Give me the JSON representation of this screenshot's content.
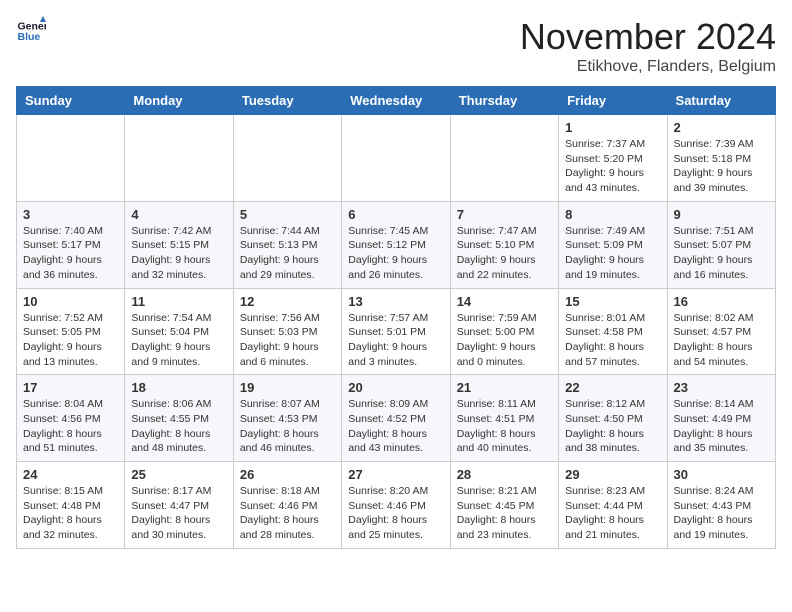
{
  "logo": {
    "line1": "General",
    "line2": "Blue"
  },
  "title": "November 2024",
  "location": "Etikhove, Flanders, Belgium",
  "days_of_week": [
    "Sunday",
    "Monday",
    "Tuesday",
    "Wednesday",
    "Thursday",
    "Friday",
    "Saturday"
  ],
  "weeks": [
    [
      {
        "day": "",
        "info": ""
      },
      {
        "day": "",
        "info": ""
      },
      {
        "day": "",
        "info": ""
      },
      {
        "day": "",
        "info": ""
      },
      {
        "day": "",
        "info": ""
      },
      {
        "day": "1",
        "info": "Sunrise: 7:37 AM\nSunset: 5:20 PM\nDaylight: 9 hours and 43 minutes."
      },
      {
        "day": "2",
        "info": "Sunrise: 7:39 AM\nSunset: 5:18 PM\nDaylight: 9 hours and 39 minutes."
      }
    ],
    [
      {
        "day": "3",
        "info": "Sunrise: 7:40 AM\nSunset: 5:17 PM\nDaylight: 9 hours and 36 minutes."
      },
      {
        "day": "4",
        "info": "Sunrise: 7:42 AM\nSunset: 5:15 PM\nDaylight: 9 hours and 32 minutes."
      },
      {
        "day": "5",
        "info": "Sunrise: 7:44 AM\nSunset: 5:13 PM\nDaylight: 9 hours and 29 minutes."
      },
      {
        "day": "6",
        "info": "Sunrise: 7:45 AM\nSunset: 5:12 PM\nDaylight: 9 hours and 26 minutes."
      },
      {
        "day": "7",
        "info": "Sunrise: 7:47 AM\nSunset: 5:10 PM\nDaylight: 9 hours and 22 minutes."
      },
      {
        "day": "8",
        "info": "Sunrise: 7:49 AM\nSunset: 5:09 PM\nDaylight: 9 hours and 19 minutes."
      },
      {
        "day": "9",
        "info": "Sunrise: 7:51 AM\nSunset: 5:07 PM\nDaylight: 9 hours and 16 minutes."
      }
    ],
    [
      {
        "day": "10",
        "info": "Sunrise: 7:52 AM\nSunset: 5:05 PM\nDaylight: 9 hours and 13 minutes."
      },
      {
        "day": "11",
        "info": "Sunrise: 7:54 AM\nSunset: 5:04 PM\nDaylight: 9 hours and 9 minutes."
      },
      {
        "day": "12",
        "info": "Sunrise: 7:56 AM\nSunset: 5:03 PM\nDaylight: 9 hours and 6 minutes."
      },
      {
        "day": "13",
        "info": "Sunrise: 7:57 AM\nSunset: 5:01 PM\nDaylight: 9 hours and 3 minutes."
      },
      {
        "day": "14",
        "info": "Sunrise: 7:59 AM\nSunset: 5:00 PM\nDaylight: 9 hours and 0 minutes."
      },
      {
        "day": "15",
        "info": "Sunrise: 8:01 AM\nSunset: 4:58 PM\nDaylight: 8 hours and 57 minutes."
      },
      {
        "day": "16",
        "info": "Sunrise: 8:02 AM\nSunset: 4:57 PM\nDaylight: 8 hours and 54 minutes."
      }
    ],
    [
      {
        "day": "17",
        "info": "Sunrise: 8:04 AM\nSunset: 4:56 PM\nDaylight: 8 hours and 51 minutes."
      },
      {
        "day": "18",
        "info": "Sunrise: 8:06 AM\nSunset: 4:55 PM\nDaylight: 8 hours and 48 minutes."
      },
      {
        "day": "19",
        "info": "Sunrise: 8:07 AM\nSunset: 4:53 PM\nDaylight: 8 hours and 46 minutes."
      },
      {
        "day": "20",
        "info": "Sunrise: 8:09 AM\nSunset: 4:52 PM\nDaylight: 8 hours and 43 minutes."
      },
      {
        "day": "21",
        "info": "Sunrise: 8:11 AM\nSunset: 4:51 PM\nDaylight: 8 hours and 40 minutes."
      },
      {
        "day": "22",
        "info": "Sunrise: 8:12 AM\nSunset: 4:50 PM\nDaylight: 8 hours and 38 minutes."
      },
      {
        "day": "23",
        "info": "Sunrise: 8:14 AM\nSunset: 4:49 PM\nDaylight: 8 hours and 35 minutes."
      }
    ],
    [
      {
        "day": "24",
        "info": "Sunrise: 8:15 AM\nSunset: 4:48 PM\nDaylight: 8 hours and 32 minutes."
      },
      {
        "day": "25",
        "info": "Sunrise: 8:17 AM\nSunset: 4:47 PM\nDaylight: 8 hours and 30 minutes."
      },
      {
        "day": "26",
        "info": "Sunrise: 8:18 AM\nSunset: 4:46 PM\nDaylight: 8 hours and 28 minutes."
      },
      {
        "day": "27",
        "info": "Sunrise: 8:20 AM\nSunset: 4:46 PM\nDaylight: 8 hours and 25 minutes."
      },
      {
        "day": "28",
        "info": "Sunrise: 8:21 AM\nSunset: 4:45 PM\nDaylight: 8 hours and 23 minutes."
      },
      {
        "day": "29",
        "info": "Sunrise: 8:23 AM\nSunset: 4:44 PM\nDaylight: 8 hours and 21 minutes."
      },
      {
        "day": "30",
        "info": "Sunrise: 8:24 AM\nSunset: 4:43 PM\nDaylight: 8 hours and 19 minutes."
      }
    ]
  ]
}
